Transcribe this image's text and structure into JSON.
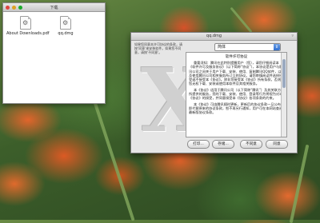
{
  "finder": {
    "title": "下载",
    "files": [
      {
        "name": "About Downloads.pdf",
        "icon": "pdf-document-icon"
      },
      {
        "name": "qq.dmg",
        "icon": "disk-image-icon"
      }
    ]
  },
  "license_dialog": {
    "title": "qq.dmg",
    "intro": "如果您同意本许可协议的条款，请按'同意'来安装软件。如果您不同意，请按'不同意'。",
    "language": "简体",
    "heading": "软件许可协议",
    "paragraphs": [
      "重要须知：腾讯在此特别提醒用户（您），请您仔细阅读本《软件许可及服务协议》（以下简称“协议”），本协议是用户与腾讯公司之间关于用户下载、安装、使用、复制腾讯QQ软件，以及使用腾讯公司相关服务所订立的协议。请您审慎阅读并选择接受或不接受本《协议》。除非您接受本《协议》所有条款，否则您无权下载、安装或使用本软件及其相关服务。",
      "本《协议》适用于腾讯公司（以下简称“腾讯”）及其关联方所提供的服务，您的下载、安装、使用、登录等行为将视为对本《协议》的接受，并同意接受本《协议》各项条款的约束。",
      "本《协议》可由腾讯随时更新，更新后的协议条款一旦公布即代替原来的协议条款，恕不再另行通知，用户可在本网站查阅最新版协议条款。"
    ],
    "buttons": {
      "print": "打印…",
      "save": "存储…",
      "disagree": "不同意",
      "agree": "同意"
    }
  },
  "colors": {
    "dialog_bg": "#e6e6e6",
    "scroll_thumb": "#9aa9c0",
    "popup_arrow": "#2f6fd1"
  }
}
